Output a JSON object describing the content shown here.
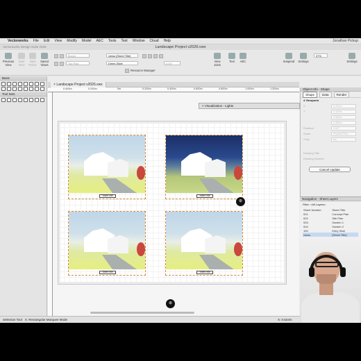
{
  "menubar": {
    "apple": "",
    "app": "Vectorworks",
    "items": [
      "File",
      "Edit",
      "View",
      "Modify",
      "Model",
      "AEC",
      "Tools",
      "Text",
      "Window",
      "Cloud",
      "Help"
    ],
    "user": "Jonathan Pickup"
  },
  "window": {
    "title": "Landscape Project v2026.vwx",
    "app_title": "Vectorworks Design Suite 2026"
  },
  "toolbar": {
    "previous_view": "Previous View",
    "next_view": "Next View",
    "next_pview": "Next Pview",
    "saved_views": "Saved Views",
    "layer_combo": "views [Sheet Title]",
    "class_combo": "Boxes",
    "top_combo": "Top Plan",
    "render_combo": "Dimm-Slide",
    "zoom": "0.00°",
    "resource_manager": "Resource Manager",
    "view_joins": "View Joins",
    "text": "Text",
    "aec": "AEC",
    "suspend": "Suspend",
    "settings": "Settings",
    "zoom_pct": "37%",
    "accent": "#1a73e8"
  },
  "tool_sets": {
    "title": "Tool Sets",
    "basic_title": "Basic"
  },
  "document": {
    "tab": "Landscape Project v2026.vwx",
    "ruler_labels": [
      "0.400m",
      "0.200m",
      "0m",
      "0.200m",
      "0.400m",
      "0.600m",
      "0.800m",
      "1.000m",
      "1.200m"
    ],
    "viewports": [
      {
        "caption": "Sheet Title",
        "style": "day"
      },
      {
        "caption": "Sheet Title",
        "style": "night"
      },
      {
        "caption": "Sheet Title",
        "style": "day"
      },
      {
        "caption": "Sheet Title",
        "style": "day"
      }
    ],
    "badge_glyph": "⊛"
  },
  "viz_palette": {
    "title": "Visualization - Lights"
  },
  "object_info": {
    "title": "Object Info - Shape",
    "tabs": [
      "Shape",
      "Data",
      "Render"
    ],
    "selection": "4 Viewports",
    "fields": [
      {
        "label": "X",
        "value": "0.224m"
      },
      {
        "label": "Y",
        "value": "0.120m"
      },
      {
        "label": "",
        "value": "0.500m"
      },
      {
        "label": "",
        "value": "0.350m"
      },
      {
        "label": "Rotation",
        "value": "0.00°"
      },
      {
        "label": "Scale",
        "value": "Shaded Ren..."
      },
      {
        "label": "Crop",
        "value": "No"
      }
    ],
    "cancel_update": "Cancel Update",
    "drawing_title": "Drawing Title",
    "drawing_number": "Drawing Number"
  },
  "navigation": {
    "title": "Navigation - Sheet Layers",
    "filter": "Filter:  <All Layers>",
    "columns": [
      "Sheet Number",
      "Sheet Title"
    ],
    "rows": [
      {
        "num": "001",
        "title": "Concept Plan",
        "selected": false
      },
      {
        "num": "002",
        "title": "Site Plan",
        "selected": false
      },
      {
        "num": "003",
        "title": "Garden 1",
        "selected": false
      },
      {
        "num": "004",
        "title": "Garden 2",
        "selected": false
      },
      {
        "num": "100",
        "title": "Entry Stair",
        "selected": false
      },
      {
        "num": "views",
        "title": "[Sheet Title]",
        "selected": true
      }
    ]
  },
  "status": {
    "left": "Selection Tool",
    "mode": "X:  Rectangular Marquee Mode",
    "x": "X: 0.624m",
    "y": "Y: 0.000m"
  }
}
